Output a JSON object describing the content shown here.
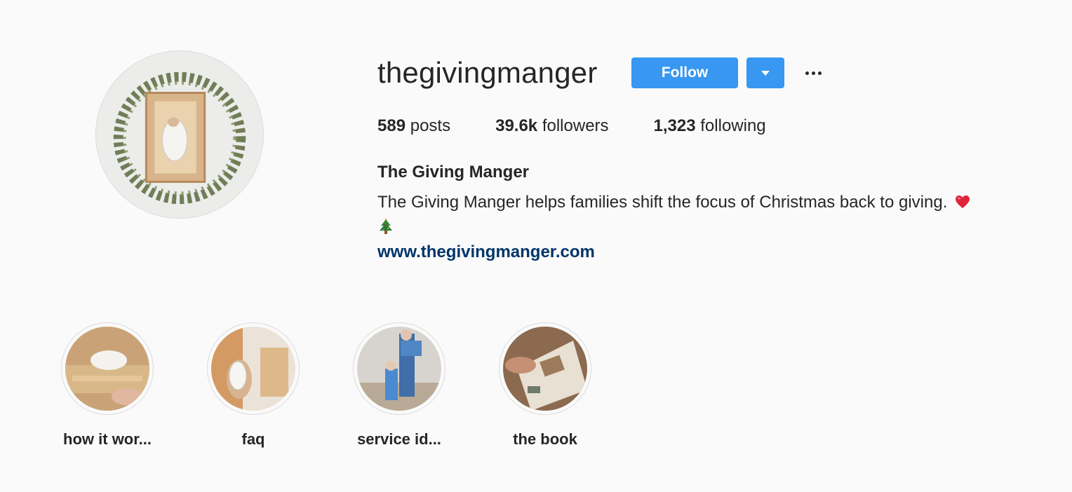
{
  "profile": {
    "username": "thegivingmanger",
    "follow_label": "Follow",
    "dropdown_icon": "caret-down-icon",
    "more_icon": "ellipsis-icon",
    "stats": [
      {
        "count": "589",
        "label": "posts"
      },
      {
        "count": "39.6k",
        "label": "followers"
      },
      {
        "count": "1,323",
        "label": "following"
      }
    ],
    "full_name": "The Giving Manger",
    "bio": "The Giving Manger helps families shift the focus of Christmas back to giving.",
    "bio_emoji": [
      "red-heart",
      "christmas-tree"
    ],
    "website": "www.thegivingmanger.com"
  },
  "highlights": [
    {
      "label": "how it wor..."
    },
    {
      "label": "faq"
    },
    {
      "label": "service id..."
    },
    {
      "label": "the book"
    }
  ],
  "colors": {
    "accent": "#3897f0",
    "link": "#003569",
    "background": "#fafafa"
  }
}
